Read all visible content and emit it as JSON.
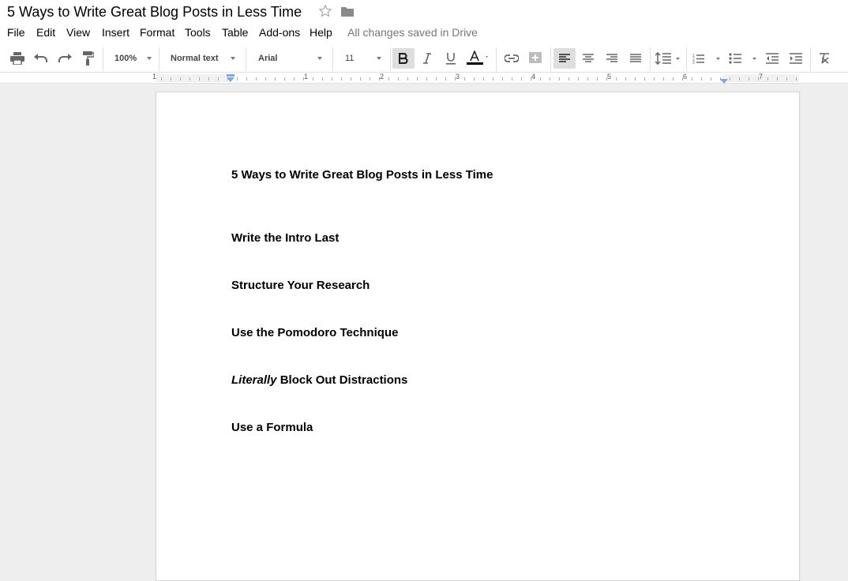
{
  "window": {
    "doc_title": "5 Ways to Write Great Blog Posts in Less Time"
  },
  "menu": {
    "items": [
      {
        "label": "File"
      },
      {
        "label": "Edit"
      },
      {
        "label": "View"
      },
      {
        "label": "Insert"
      },
      {
        "label": "Format"
      },
      {
        "label": "Tools"
      },
      {
        "label": "Table"
      },
      {
        "label": "Add-ons"
      },
      {
        "label": "Help"
      }
    ],
    "save_status": "All changes saved in Drive"
  },
  "toolbar": {
    "zoom": "100%",
    "style": "Normal text",
    "font": "Arial",
    "font_size": "11",
    "text_color": "#000000",
    "icons": [
      "print-icon",
      "undo-icon",
      "redo-icon",
      "paint-format-icon",
      "bold-icon",
      "italic-icon",
      "underline-icon",
      "text-color-icon",
      "link-icon",
      "comment-icon",
      "align-left-icon",
      "align-center-icon",
      "align-right-icon",
      "justify-icon",
      "line-spacing-icon",
      "numbered-list-icon",
      "bulleted-list-icon",
      "decrease-indent-icon",
      "increase-indent-icon",
      "clear-formatting-icon"
    ]
  },
  "ruler": {
    "numbers": [
      "1",
      "1",
      "2",
      "3",
      "4",
      "5",
      "6",
      "7"
    ]
  },
  "document": {
    "heading": "5 Ways to Write Great Blog Posts in Less Time",
    "lines": [
      {
        "text": "Write the Intro Last"
      },
      {
        "text": "Structure Your Research"
      },
      {
        "text": "Use the Pomodoro Technique"
      },
      {
        "italic_prefix": "Literally",
        "text": " Block Out Distractions"
      },
      {
        "text": "Use a Formula"
      }
    ]
  }
}
